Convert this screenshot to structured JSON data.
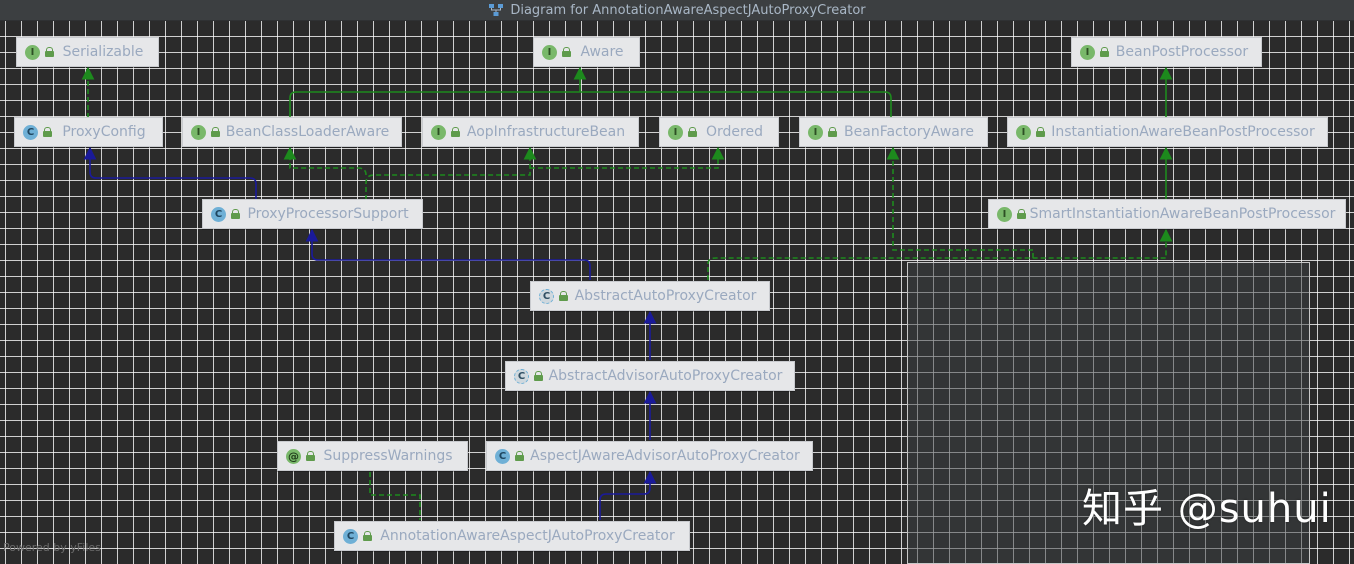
{
  "window": {
    "title": "Diagram for AnnotationAwareAspectJAutoProxyCreator",
    "title_icon": "diagram-icon"
  },
  "colors": {
    "implements_edge": "#1d8a1d",
    "extends_edge": "#1a1a9a",
    "node_bg": "#e6e7e9",
    "node_text": "#9aa9bf"
  },
  "nodes": {
    "serializable": {
      "label": "Serializable",
      "kind": "I"
    },
    "aware": {
      "label": "Aware",
      "kind": "I"
    },
    "bean_post_processor": {
      "label": "BeanPostProcessor",
      "kind": "I"
    },
    "proxy_config": {
      "label": "ProxyConfig",
      "kind": "C"
    },
    "bean_class_loader_aware": {
      "label": "BeanClassLoaderAware",
      "kind": "I"
    },
    "aop_infrastructure_bean": {
      "label": "AopInfrastructureBean",
      "kind": "I"
    },
    "ordered": {
      "label": "Ordered",
      "kind": "I"
    },
    "bean_factory_aware": {
      "label": "BeanFactoryAware",
      "kind": "I"
    },
    "instantiation_aware_bpp": {
      "label": "InstantiationAwareBeanPostProcessor",
      "kind": "I"
    },
    "proxy_processor_support": {
      "label": "ProxyProcessorSupport",
      "kind": "C"
    },
    "smart_instantiation_aware_bpp": {
      "label": "SmartInstantiationAwareBeanPostProcessor",
      "kind": "I"
    },
    "abstract_auto_proxy_creator": {
      "label": "AbstractAutoProxyCreator",
      "kind": "C"
    },
    "abstract_advisor_auto_proxy_creator": {
      "label": "AbstractAdvisorAutoProxyCreator",
      "kind": "C"
    },
    "suppress_warnings": {
      "label": "SuppressWarnings",
      "kind": "@"
    },
    "aspectj_aware_advisor_auto_proxy_creator": {
      "label": "AspectJAwareAdvisorAutoProxyCreator",
      "kind": "C"
    },
    "annotation_aware_aspectj_auto_proxy_creator": {
      "label": "AnnotationAwareAspectJAutoProxyCreator",
      "kind": "C"
    }
  },
  "footer": {
    "powered_by": "Powered by yFiles"
  },
  "watermark": "知乎 @suhui"
}
